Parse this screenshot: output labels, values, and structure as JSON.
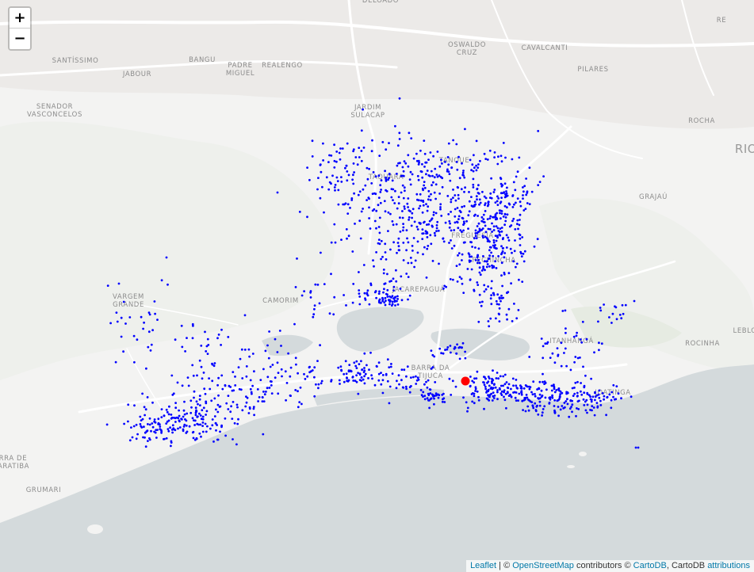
{
  "map": {
    "zoom_in_label": "+",
    "zoom_out_label": "−",
    "attribution": {
      "leaflet": "Leaflet",
      "sep1": " | © ",
      "osm": "OpenStreetMap",
      "contrib": " contributors © ",
      "cartodb": "CartoDB",
      "sep2": ", CartoDB ",
      "attributions": "attributions"
    },
    "place_labels": [
      {
        "lines": [
          "DELOADO"
        ]
      },
      {
        "lines": [
          "SANTÍSSIMO"
        ]
      },
      {
        "lines": [
          "BANGU"
        ]
      },
      {
        "lines": [
          "PADRE",
          "MIGUEL"
        ]
      },
      {
        "lines": [
          "REALENGO"
        ]
      },
      {
        "lines": [
          "OSWALDO",
          "CRUZ"
        ]
      },
      {
        "lines": [
          "CAVALCANTI"
        ]
      },
      {
        "lines": [
          "PILARES"
        ]
      },
      {
        "lines": [
          "JABOUR"
        ]
      },
      {
        "lines": [
          "RE"
        ]
      },
      {
        "lines": [
          "SENADOR",
          "VASCONCELOS"
        ]
      },
      {
        "lines": [
          "JARDIM",
          "SULACAP"
        ]
      },
      {
        "lines": [
          "ROCHA"
        ]
      },
      {
        "lines": [
          "RIO"
        ]
      },
      {
        "lines": [
          "TANQUE"
        ]
      },
      {
        "lines": [
          "TAQUARA"
        ]
      },
      {
        "lines": [
          "GRAJAÚ"
        ]
      },
      {
        "lines": [
          "FREGUESIA"
        ]
      },
      {
        "lines": [
          "PECHINCHA"
        ]
      },
      {
        "lines": [
          "JACAREPAGUÁ"
        ]
      },
      {
        "lines": [
          "CAMORIM"
        ]
      },
      {
        "lines": [
          "VARGEM",
          "GRANDE"
        ]
      },
      {
        "lines": [
          "ITANHANGÁ"
        ]
      },
      {
        "lines": [
          "LEBLON"
        ]
      },
      {
        "lines": [
          "ROCINHA"
        ]
      },
      {
        "lines": [
          "BARRA DA",
          "TIJUCA"
        ]
      },
      {
        "lines": [
          "JOATINGA"
        ]
      },
      {
        "lines": [
          "BARRA DE",
          "GUARATIBA"
        ]
      },
      {
        "lines": [
          "GRUMARI"
        ]
      }
    ],
    "layers": {
      "points_color": "#0000ff",
      "highlight_color": "#ff0000",
      "basemap": "CartoDB Positron"
    }
  }
}
